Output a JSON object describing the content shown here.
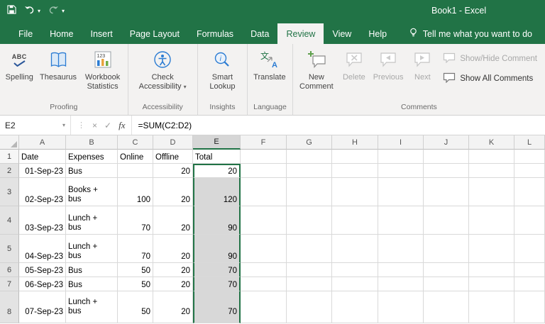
{
  "titlebar": {
    "title": "Book1  -  Excel"
  },
  "tabs": {
    "items": [
      "File",
      "Home",
      "Insert",
      "Page Layout",
      "Formulas",
      "Data",
      "Review",
      "View",
      "Help"
    ],
    "active": "Review"
  },
  "search": {
    "label": "Tell me what you want to do"
  },
  "ribbon": {
    "groups": [
      {
        "label": "Proofing",
        "buttons": [
          {
            "label": "Spelling"
          },
          {
            "label": "Thesaurus"
          },
          {
            "label": "Workbook Statistics"
          }
        ]
      },
      {
        "label": "Accessibility",
        "buttons": [
          {
            "label": "Check Accessibility",
            "has_dropdown": true
          }
        ]
      },
      {
        "label": "Insights",
        "buttons": [
          {
            "label": "Smart Lookup"
          }
        ]
      },
      {
        "label": "Language",
        "buttons": [
          {
            "label": "Translate"
          }
        ]
      },
      {
        "label": "Comments",
        "buttons": [
          {
            "label": "New Comment"
          },
          {
            "label": "Delete",
            "disabled": true
          },
          {
            "label": "Previous",
            "disabled": true
          },
          {
            "label": "Next",
            "disabled": true
          }
        ],
        "toggles": [
          {
            "label": "Show/Hide Comment",
            "disabled": true
          },
          {
            "label": "Show All Comments",
            "disabled": false
          }
        ]
      }
    ]
  },
  "formula_bar": {
    "name_box": "E2",
    "formula": "=SUM(C2:D2)",
    "fx_label": "fx"
  },
  "icons": {
    "abc": "ABC",
    "numbers": "123",
    "info": "i",
    "translate_from": "文",
    "translate_to": "A",
    "caret_down": "▾",
    "dots": "⋮",
    "cancel": "×",
    "enter": "✓"
  },
  "grid": {
    "col_headers": [
      "A",
      "B",
      "C",
      "D",
      "E",
      "F",
      "G",
      "H",
      "I",
      "J",
      "K",
      "L"
    ],
    "selected_column": "E",
    "active_cell": "E2",
    "rows": [
      {
        "n": "1",
        "a": "Date",
        "b": "Expenses",
        "c": "Online",
        "d": "Offline",
        "e": "Total"
      },
      {
        "n": "2",
        "a": "01-Sep-23",
        "b": "Bus",
        "c": "",
        "d": "20",
        "e": "20"
      },
      {
        "n": "3",
        "a": "02-Sep-23",
        "b": "Books +\nbus",
        "c": "100",
        "d": "20",
        "e": "120"
      },
      {
        "n": "4",
        "a": "03-Sep-23",
        "b": "Lunch +\nbus",
        "c": "70",
        "d": "20",
        "e": "90"
      },
      {
        "n": "5",
        "a": "04-Sep-23",
        "b": "Lunch +\nbus",
        "c": "70",
        "d": "20",
        "e": "90"
      },
      {
        "n": "6",
        "a": "05-Sep-23",
        "b": "Bus",
        "c": "50",
        "d": "20",
        "e": "70"
      },
      {
        "n": "7",
        "a": "06-Sep-23",
        "b": "Bus",
        "c": "50",
        "d": "20",
        "e": "70"
      },
      {
        "n": "8",
        "a": "07-Sep-23",
        "b": "Lunch +\nbus",
        "c": "50",
        "d": "20",
        "e": "70"
      }
    ]
  },
  "colors": {
    "brand_green": "#217346",
    "selection_fill": "#d8d8d8"
  }
}
